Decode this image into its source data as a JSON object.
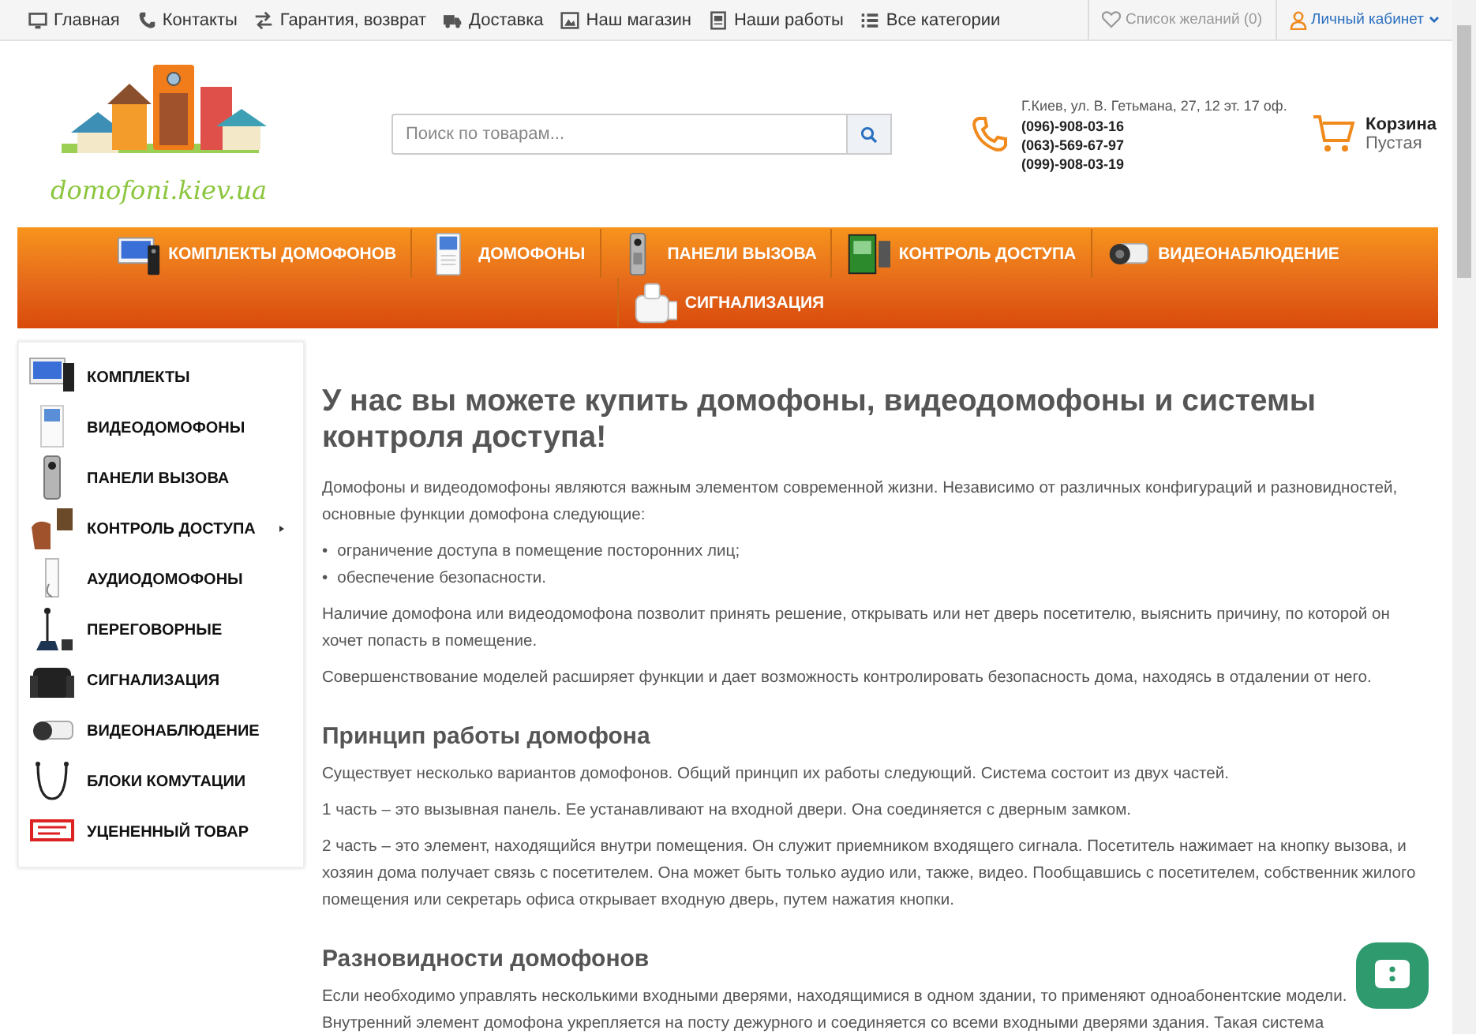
{
  "top_bar": {
    "links": [
      {
        "label": "Главная"
      },
      {
        "label": "Контакты"
      },
      {
        "label": "Гарантия, возврат"
      },
      {
        "label": "Доставка"
      },
      {
        "label": "Наш магазин"
      },
      {
        "label": "Наши работы"
      },
      {
        "label": "Все категории"
      }
    ],
    "wishlist": "Список желаний (0)",
    "account": "Личный кабинет"
  },
  "header": {
    "logo_text": "domofoni.kiev.ua",
    "search": {
      "placeholder": "Поиск по товарам..."
    },
    "address": "Г.Киев, ул. В. Гетьмана, 27, 12 эт. 17 оф.",
    "phones": [
      "(096)-908-03-16",
      "(063)-569-67-97",
      "(099)-908-03-19"
    ],
    "cart": {
      "title": "Корзина",
      "status": "Пустая"
    }
  },
  "main_nav": [
    {
      "label": "КОМПЛЕКТЫ ДОМОФОНОВ"
    },
    {
      "label": "ДОМОФОНЫ"
    },
    {
      "label": "ПАНЕЛИ ВЫЗОВА"
    },
    {
      "label": "КОНТРОЛЬ ДОСТУПА"
    },
    {
      "label": "ВИДЕОНАБЛЮДЕНИЕ"
    },
    {
      "label": "СИГНАЛИЗАЦИЯ"
    }
  ],
  "sidebar": {
    "items": [
      {
        "label": "КОМПЛЕКТЫ",
        "has_submenu": false
      },
      {
        "label": "ВИДЕОДОМОФОНЫ",
        "has_submenu": false
      },
      {
        "label": "ПАНЕЛИ ВЫЗОВА",
        "has_submenu": false
      },
      {
        "label": "КОНТРОЛЬ ДОСТУПА",
        "has_submenu": true
      },
      {
        "label": "АУДИОДОМОФОНЫ",
        "has_submenu": false
      },
      {
        "label": "ПЕРЕГОВОРНЫЕ",
        "has_submenu": false
      },
      {
        "label": "СИГНАЛИЗАЦИЯ",
        "has_submenu": false
      },
      {
        "label": "ВИДЕОНАБЛЮДЕНИЕ",
        "has_submenu": false
      },
      {
        "label": "БЛОКИ КОМУТАЦИИ",
        "has_submenu": false
      },
      {
        "label": "УЦЕНЕННЫЙ ТОВАР",
        "has_submenu": false
      }
    ]
  },
  "content": [
    {
      "kind": "title",
      "text": "У нас вы можете купить домофоны, видеодомофоны и системы контроля доступа!"
    },
    {
      "kind": "paragraph",
      "text": "Домофоны и видеодомофоны являются важным элементом современной жизни. Независимо от различных конфигураций и разновидностей, основные функции домофона следующие:"
    },
    {
      "kind": "bullets",
      "marker": "•",
      "items": [
        "ограничение доступа в помещение посторонних лиц;",
        "обеспечение безопасности."
      ]
    },
    {
      "kind": "paragraph",
      "text": "Наличие домофона или видеодомофона позволит принять решение, открывать или нет дверь посетителю, выяснить причину, по которой он хочет попасть в помещение."
    },
    {
      "kind": "paragraph",
      "text": "Совершенствование моделей расширяет функции и дает возможность контролировать безопасность дома, находясь в отдалении от него."
    },
    {
      "kind": "heading",
      "text": "Принцип работы домофона"
    },
    {
      "kind": "paragraph",
      "text": "Существует несколько вариантов домофонов. Общий принцип их работы следующий. Система состоит из двух  частей."
    },
    {
      "kind": "paragraph",
      "text": "1 часть – это вызывная панель. Ее устанавливают на входной двери. Она соединяется с дверным замком."
    },
    {
      "kind": "paragraph",
      "text": "2 часть – это элемент, находящийся внутри помещения. Он служит приемником входящего сигнала. Посетитель нажимает на кнопку вызова, и хозяин дома получает связь с посетителем. Она может быть только аудио или, также,  видео. Пообщавшись с посетителем, собственник жилого помещения или секретарь офиса открывает входную дверь, путем нажатия кнопки."
    },
    {
      "kind": "heading",
      "text": "Разновидности домофонов"
    },
    {
      "kind": "paragraph",
      "text": "Если необходимо управлять несколькими входными дверями, находящимися в одном здании, то применяют  одноабонентские модели. Внутренний элемент домофона укрепляется на посту дежурного и соединяется со всеми входными дверями здания. Такая система"
    }
  ]
}
